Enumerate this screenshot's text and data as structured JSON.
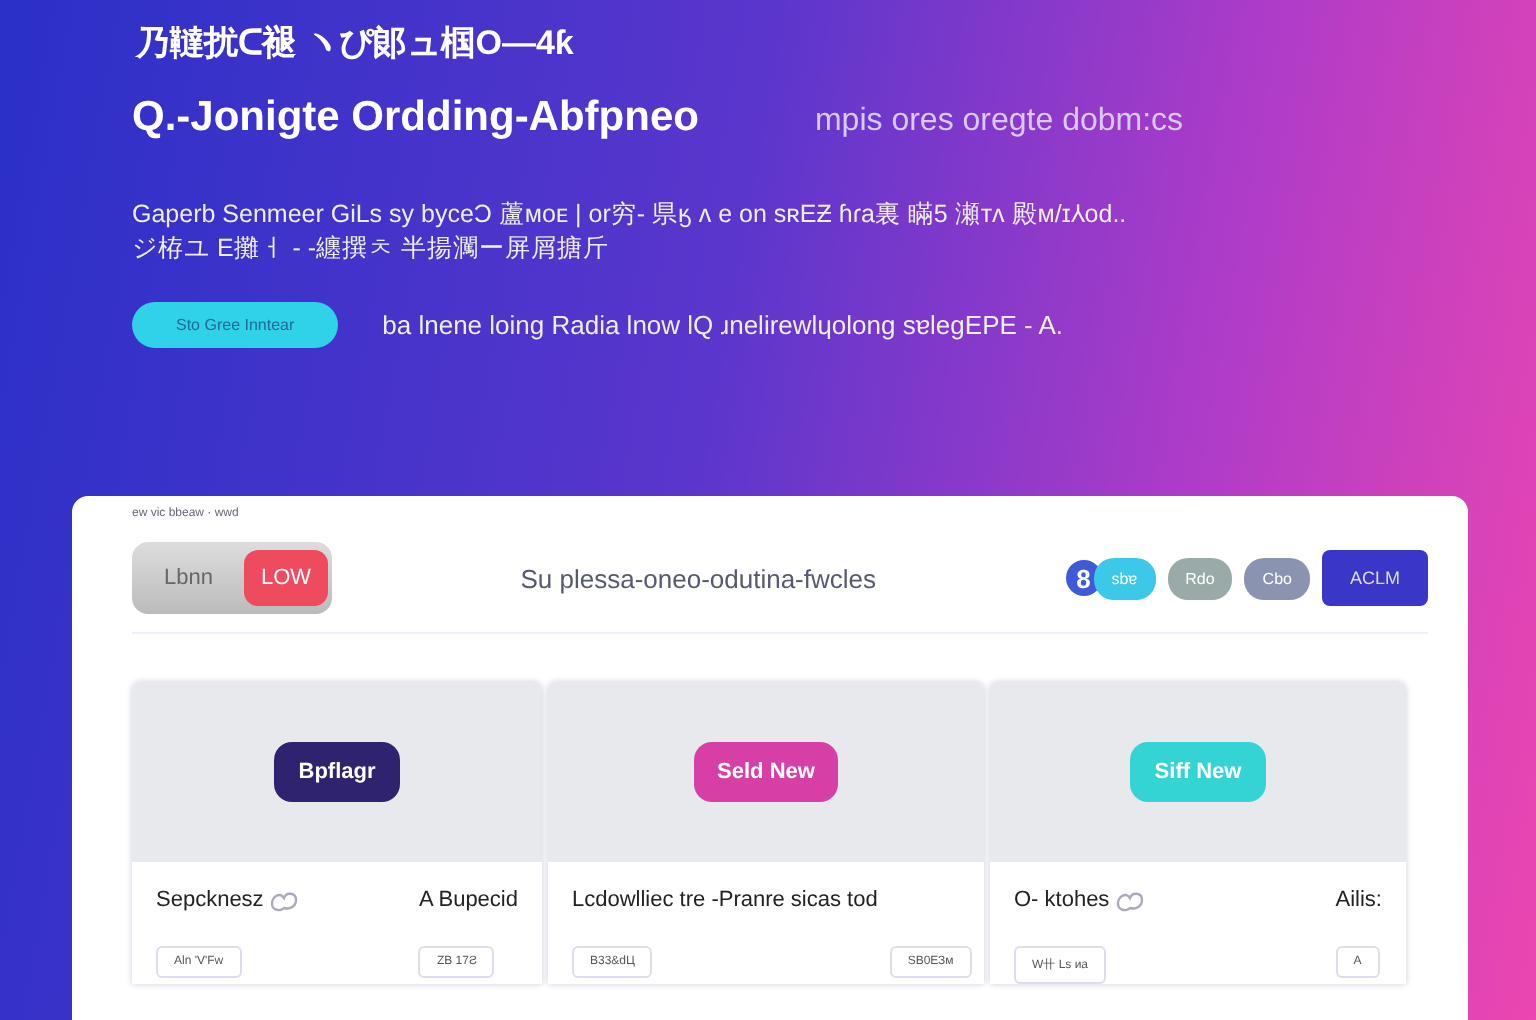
{
  "hero": {
    "eyebrow": "乃韃扰ᑕ褪 ヽぴ郞ュ椢O—4ƙ",
    "title": "Q.-Jonigte Ordding-Abfpneo",
    "title_aside": "mpis ores oregte dobm:cs",
    "description": [
      "Gaperb Senmeer GiLs sy byceƆ 蘆ᴍᴏᴇ | or穷- 県ӄ ʌ e on sʀEƵ ɦɾa裏 瞞5 瀬ᴛᴧ 殿ᴍ/ɪ⅄od..",
      "ジ栫ユ  E攤ㅓ  - -纏撰ㅊ        半揚㶒ー屏屑搪斤"
    ],
    "cta": "Sto Gree Inntear",
    "cta_note": "ba lnene loing Radia lnow lQ ɹnelirewlɥolong sɐlegEPE - A."
  },
  "panel": {
    "caption": "ew vic bbeaw   ·  wwd",
    "toggle": [
      {
        "label": "Lbnn",
        "selected": false
      },
      {
        "label": "LOW",
        "selected": true
      }
    ],
    "title": "Su plessa-oneo-odutina-fwcles",
    "chips": [
      {
        "label": "sbɐ",
        "color": "#3cc8e8"
      },
      {
        "label": "Rdo",
        "color": "#9aaaa8"
      },
      {
        "label": "Cbo",
        "color": "#8a94b0"
      }
    ],
    "avatar": "8",
    "action": "ACLM"
  },
  "cards": [
    {
      "button": "Bpflagr",
      "color": "#2f2370",
      "items": [
        {
          "title": "Sepcknesz",
          "icon": true,
          "chip": "Aln 'V'Fw"
        },
        {
          "title": "A Bupecid",
          "icon": false,
          "chip": "ZB 17Ƨ"
        }
      ]
    },
    {
      "button": "Seld New",
      "color": "#d83fa6",
      "items": [
        {
          "title": "Lcdowlliec tre -Pranre sicas tod",
          "icon": false,
          "chip": "B33&dЦ"
        },
        {
          "icon": false,
          "chip": "SB0ЕЗм"
        }
      ]
    },
    {
      "button": "Siff New",
      "color": "#35d4d4",
      "items": [
        {
          "title": "O- ktohes",
          "icon": true,
          "chip": "W卄 Ls ᴎa"
        },
        {
          "title": "Ailis:",
          "icon": false,
          "chip": "A"
        }
      ]
    }
  ]
}
